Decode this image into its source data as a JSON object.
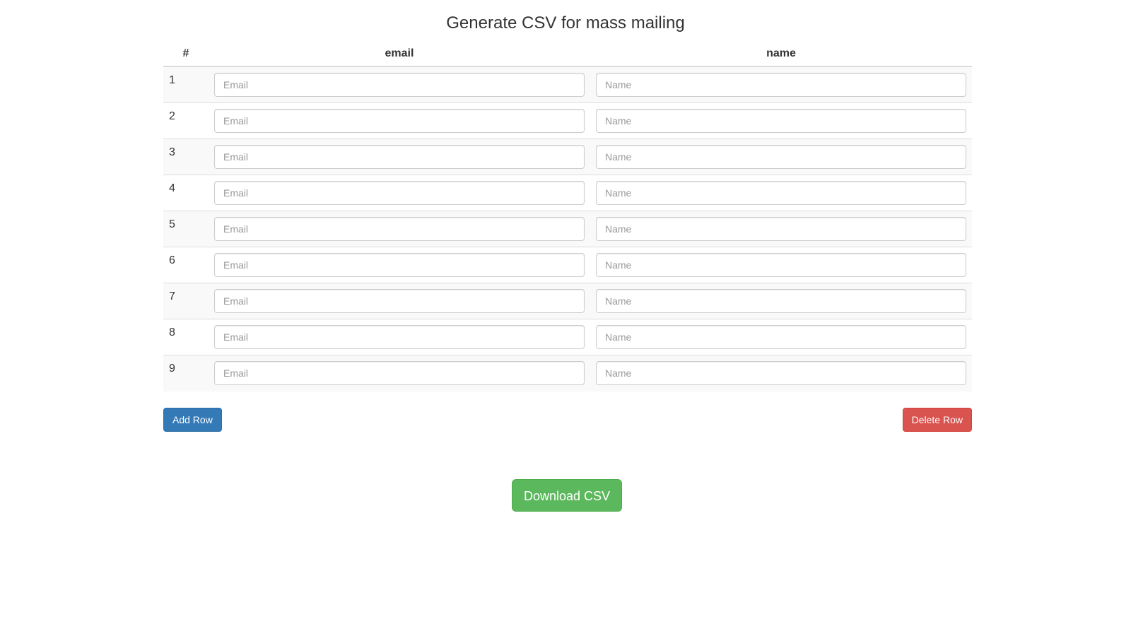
{
  "page": {
    "title": "Generate CSV for mass mailing"
  },
  "table": {
    "headers": {
      "num": "#",
      "email": "email",
      "name": "name"
    },
    "rows": [
      {
        "num": "1",
        "email_value": "",
        "email_placeholder": "Email",
        "name_value": "",
        "name_placeholder": "Name"
      },
      {
        "num": "2",
        "email_value": "",
        "email_placeholder": "Email",
        "name_value": "",
        "name_placeholder": "Name"
      },
      {
        "num": "3",
        "email_value": "",
        "email_placeholder": "Email",
        "name_value": "",
        "name_placeholder": "Name"
      },
      {
        "num": "4",
        "email_value": "",
        "email_placeholder": "Email",
        "name_value": "",
        "name_placeholder": "Name"
      },
      {
        "num": "5",
        "email_value": "",
        "email_placeholder": "Email",
        "name_value": "",
        "name_placeholder": "Name"
      },
      {
        "num": "6",
        "email_value": "",
        "email_placeholder": "Email",
        "name_value": "",
        "name_placeholder": "Name"
      },
      {
        "num": "7",
        "email_value": "",
        "email_placeholder": "Email",
        "name_value": "",
        "name_placeholder": "Name"
      },
      {
        "num": "8",
        "email_value": "",
        "email_placeholder": "Email",
        "name_value": "",
        "name_placeholder": "Name"
      },
      {
        "num": "9",
        "email_value": "",
        "email_placeholder": "Email",
        "name_value": "",
        "name_placeholder": "Name"
      }
    ]
  },
  "actions": {
    "add_row_label": "Add Row",
    "delete_row_label": "Delete Row",
    "download_label": "Download CSV"
  },
  "colors": {
    "primary": "#337ab7",
    "danger": "#d9534f",
    "success": "#5cb85c"
  }
}
